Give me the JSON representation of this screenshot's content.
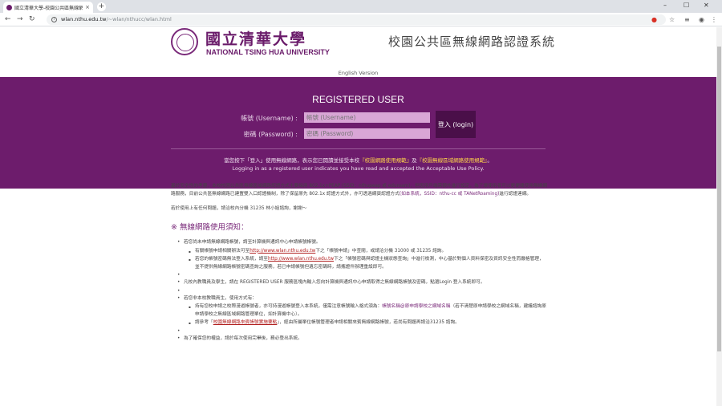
{
  "browser": {
    "tab_title": "國立清華大學-校園公共區無線網",
    "tab_close": "×",
    "new_tab": "+",
    "url_host": "wlan.nthu.edu.tw",
    "url_path": "/~wlan/nthucc/wlan.html",
    "win_min": "–",
    "win_max": "☐",
    "win_close": "✕"
  },
  "header": {
    "university_cn": "國立清華大學",
    "university_en": "NATIONAL TSING HUA UNIVERSITY",
    "site_title": "校園公共區無線網路認證系統",
    "lang_link": "English Version"
  },
  "login": {
    "title": "REGISTERED USER",
    "username_label": "帳號 (Username) :",
    "username_placeholder": "帳號 (Username)",
    "password_label": "密碼 (Password) :",
    "password_placeholder": "密碼 (Password)",
    "button": "登入 (login)",
    "notice_1": "當您按下「登入」使用無線網路，表示您已閱讀並接受本校",
    "notice_link_1": "『校園網路使用規範』",
    "notice_and": "及",
    "notice_link_2": "『校園無線區域網路使用規範』",
    "notice_end": "。",
    "notice_en": "Logging in as a registered user indicates you have read and accepted the Acceptable Use Policy."
  },
  "content": {
    "para1_a": "基於安全性的考量，本校校園公共區無線區域網路認證方式主要採用 802.1x+PEAP (SSID：nthupeap 或 eduroam)，但因用戶端需額外進行設定，為了讓使用者可以更便捷使用無線網路服務，目前公共區無線網路已建置雙入口認證機制，除了保留原先 802.1x 認證方式外，亦可透過網頁認證方式",
    "para1_link": "(如本系統，SSID：nthu-cc 或 TANetRoaming)",
    "para1_b": "進行認證連網。",
    "para2": "若於使用上有任何問題，請洽校內分機 31235 林小姐諮詢，謝謝～",
    "section_title": "※ 無線網路使用須知：",
    "b1": "若您尚未申請無線網路帳號，請至計算機與通訊中心申請帳號帳號。",
    "b1_s1_a": "有關帳號申請相關辦法可至",
    "b1_s1_link": "http://www.wlan.nthu.edu.tw",
    "b1_s1_b": "下之「帳號申請」中查閱，或請洽分機 31000 或 31235 諮詢。",
    "b1_s2_a": "若您的帳號密碼無法登入系統，請至",
    "b1_s2_link": "http://www.wlan.nthu.edu.tw",
    "b1_s2_b": "下之「帳號密碼與認證主機狀態查詢」中進行檢測，中心基於對個人資料保密及資訊安全性而嚴格管理，並不提供無線網路帳號密碼查詢之服務，若已申請帳號但遺忘密碼時，請攜證件辦理重設即可。",
    "b2": "凡校內教職員及學生，請在 REGISTERED USER 服務區塊內輸入您向計算機與通訊中心申請取得之無線網路帳號及密碼，點選Login 登入系統即可。",
    "b3": "若您非本校教職員生，使用方式有：",
    "b3_s1_a": "持有您校申請之校際漫遊帳號者，亦可持漫遊帳號登入本系統，僅需注意帳號輸入格式須為：",
    "b3_s1_hl": "帳號名稱@原申請學校之網域名稱",
    "b3_s1_b": "（若不清楚原申請學校之網域名稱，建議諮詢原申請學校之無線區域網路管理單位，如計算機中心）。",
    "b3_s2_a": "請參考「",
    "b3_s2_link": "校園無線網路來賓帳號實施要點",
    "b3_s2_b": "」，經由所屬單位帳號管理者申請相關來賓無線網路帳號，若尚有問題再請洽31235 諮詢。",
    "b4": "為了確保您的權益，請於每次使用完畢後，務必登出系統。"
  }
}
